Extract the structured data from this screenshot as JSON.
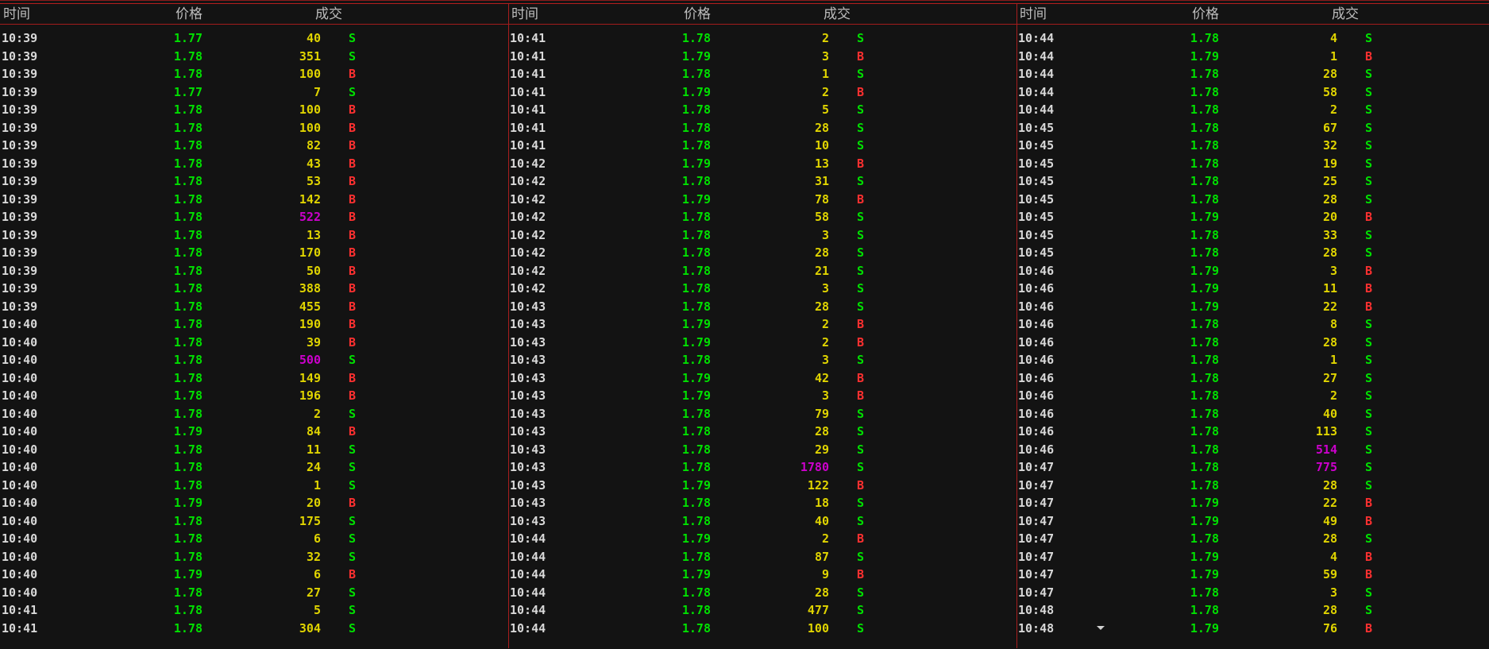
{
  "headers": {
    "time": "时间",
    "price": "价格",
    "volume": "成交"
  },
  "colors": {
    "background": "#131313",
    "price": "#00e000",
    "volume": "#e0d400",
    "volume_large": "#cc00cc",
    "buy": "#ff3030",
    "sell": "#00e000",
    "divider": "#b51f1f"
  },
  "panels": [
    {
      "rows": [
        {
          "time": "10:39",
          "price": "1.77",
          "vol": "40",
          "side": "S"
        },
        {
          "time": "10:39",
          "price": "1.78",
          "vol": "351",
          "side": "S"
        },
        {
          "time": "10:39",
          "price": "1.78",
          "vol": "100",
          "side": "B"
        },
        {
          "time": "10:39",
          "price": "1.77",
          "vol": "7",
          "side": "S"
        },
        {
          "time": "10:39",
          "price": "1.78",
          "vol": "100",
          "side": "B"
        },
        {
          "time": "10:39",
          "price": "1.78",
          "vol": "100",
          "side": "B"
        },
        {
          "time": "10:39",
          "price": "1.78",
          "vol": "82",
          "side": "B"
        },
        {
          "time": "10:39",
          "price": "1.78",
          "vol": "43",
          "side": "B"
        },
        {
          "time": "10:39",
          "price": "1.78",
          "vol": "53",
          "side": "B"
        },
        {
          "time": "10:39",
          "price": "1.78",
          "vol": "142",
          "side": "B"
        },
        {
          "time": "10:39",
          "price": "1.78",
          "vol": "522",
          "side": "B",
          "big": true
        },
        {
          "time": "10:39",
          "price": "1.78",
          "vol": "13",
          "side": "B"
        },
        {
          "time": "10:39",
          "price": "1.78",
          "vol": "170",
          "side": "B"
        },
        {
          "time": "10:39",
          "price": "1.78",
          "vol": "50",
          "side": "B"
        },
        {
          "time": "10:39",
          "price": "1.78",
          "vol": "388",
          "side": "B"
        },
        {
          "time": "10:39",
          "price": "1.78",
          "vol": "455",
          "side": "B"
        },
        {
          "time": "10:40",
          "price": "1.78",
          "vol": "190",
          "side": "B"
        },
        {
          "time": "10:40",
          "price": "1.78",
          "vol": "39",
          "side": "B"
        },
        {
          "time": "10:40",
          "price": "1.78",
          "vol": "500",
          "side": "S",
          "big": true
        },
        {
          "time": "10:40",
          "price": "1.78",
          "vol": "149",
          "side": "B"
        },
        {
          "time": "10:40",
          "price": "1.78",
          "vol": "196",
          "side": "B"
        },
        {
          "time": "10:40",
          "price": "1.78",
          "vol": "2",
          "side": "S"
        },
        {
          "time": "10:40",
          "price": "1.79",
          "vol": "84",
          "side": "B"
        },
        {
          "time": "10:40",
          "price": "1.78",
          "vol": "11",
          "side": "S"
        },
        {
          "time": "10:40",
          "price": "1.78",
          "vol": "24",
          "side": "S"
        },
        {
          "time": "10:40",
          "price": "1.78",
          "vol": "1",
          "side": "S"
        },
        {
          "time": "10:40",
          "price": "1.79",
          "vol": "20",
          "side": "B"
        },
        {
          "time": "10:40",
          "price": "1.78",
          "vol": "175",
          "side": "S"
        },
        {
          "time": "10:40",
          "price": "1.78",
          "vol": "6",
          "side": "S"
        },
        {
          "time": "10:40",
          "price": "1.78",
          "vol": "32",
          "side": "S"
        },
        {
          "time": "10:40",
          "price": "1.79",
          "vol": "6",
          "side": "B"
        },
        {
          "time": "10:40",
          "price": "1.78",
          "vol": "27",
          "side": "S"
        },
        {
          "time": "10:41",
          "price": "1.78",
          "vol": "5",
          "side": "S"
        },
        {
          "time": "10:41",
          "price": "1.78",
          "vol": "304",
          "side": "S"
        }
      ]
    },
    {
      "rows": [
        {
          "time": "10:41",
          "price": "1.78",
          "vol": "2",
          "side": "S"
        },
        {
          "time": "10:41",
          "price": "1.79",
          "vol": "3",
          "side": "B"
        },
        {
          "time": "10:41",
          "price": "1.78",
          "vol": "1",
          "side": "S"
        },
        {
          "time": "10:41",
          "price": "1.79",
          "vol": "2",
          "side": "B"
        },
        {
          "time": "10:41",
          "price": "1.78",
          "vol": "5",
          "side": "S"
        },
        {
          "time": "10:41",
          "price": "1.78",
          "vol": "28",
          "side": "S"
        },
        {
          "time": "10:41",
          "price": "1.78",
          "vol": "10",
          "side": "S"
        },
        {
          "time": "10:42",
          "price": "1.79",
          "vol": "13",
          "side": "B"
        },
        {
          "time": "10:42",
          "price": "1.78",
          "vol": "31",
          "side": "S"
        },
        {
          "time": "10:42",
          "price": "1.79",
          "vol": "78",
          "side": "B"
        },
        {
          "time": "10:42",
          "price": "1.78",
          "vol": "58",
          "side": "S"
        },
        {
          "time": "10:42",
          "price": "1.78",
          "vol": "3",
          "side": "S"
        },
        {
          "time": "10:42",
          "price": "1.78",
          "vol": "28",
          "side": "S"
        },
        {
          "time": "10:42",
          "price": "1.78",
          "vol": "21",
          "side": "S"
        },
        {
          "time": "10:42",
          "price": "1.78",
          "vol": "3",
          "side": "S"
        },
        {
          "time": "10:43",
          "price": "1.78",
          "vol": "28",
          "side": "S"
        },
        {
          "time": "10:43",
          "price": "1.79",
          "vol": "2",
          "side": "B"
        },
        {
          "time": "10:43",
          "price": "1.79",
          "vol": "2",
          "side": "B"
        },
        {
          "time": "10:43",
          "price": "1.78",
          "vol": "3",
          "side": "S"
        },
        {
          "time": "10:43",
          "price": "1.79",
          "vol": "42",
          "side": "B"
        },
        {
          "time": "10:43",
          "price": "1.79",
          "vol": "3",
          "side": "B"
        },
        {
          "time": "10:43",
          "price": "1.78",
          "vol": "79",
          "side": "S"
        },
        {
          "time": "10:43",
          "price": "1.78",
          "vol": "28",
          "side": "S"
        },
        {
          "time": "10:43",
          "price": "1.78",
          "vol": "29",
          "side": "S"
        },
        {
          "time": "10:43",
          "price": "1.78",
          "vol": "1780",
          "side": "S",
          "big": true
        },
        {
          "time": "10:43",
          "price": "1.79",
          "vol": "122",
          "side": "B"
        },
        {
          "time": "10:43",
          "price": "1.78",
          "vol": "18",
          "side": "S"
        },
        {
          "time": "10:43",
          "price": "1.78",
          "vol": "40",
          "side": "S"
        },
        {
          "time": "10:44",
          "price": "1.79",
          "vol": "2",
          "side": "B"
        },
        {
          "time": "10:44",
          "price": "1.78",
          "vol": "87",
          "side": "S"
        },
        {
          "time": "10:44",
          "price": "1.79",
          "vol": "9",
          "side": "B"
        },
        {
          "time": "10:44",
          "price": "1.78",
          "vol": "28",
          "side": "S"
        },
        {
          "time": "10:44",
          "price": "1.78",
          "vol": "477",
          "side": "S"
        },
        {
          "time": "10:44",
          "price": "1.78",
          "vol": "100",
          "side": "S"
        }
      ]
    },
    {
      "rows": [
        {
          "time": "10:44",
          "price": "1.78",
          "vol": "4",
          "side": "S"
        },
        {
          "time": "10:44",
          "price": "1.79",
          "vol": "1",
          "side": "B"
        },
        {
          "time": "10:44",
          "price": "1.78",
          "vol": "28",
          "side": "S"
        },
        {
          "time": "10:44",
          "price": "1.78",
          "vol": "58",
          "side": "S"
        },
        {
          "time": "10:44",
          "price": "1.78",
          "vol": "2",
          "side": "S"
        },
        {
          "time": "10:45",
          "price": "1.78",
          "vol": "67",
          "side": "S"
        },
        {
          "time": "10:45",
          "price": "1.78",
          "vol": "32",
          "side": "S"
        },
        {
          "time": "10:45",
          "price": "1.78",
          "vol": "19",
          "side": "S"
        },
        {
          "time": "10:45",
          "price": "1.78",
          "vol": "25",
          "side": "S"
        },
        {
          "time": "10:45",
          "price": "1.78",
          "vol": "28",
          "side": "S"
        },
        {
          "time": "10:45",
          "price": "1.79",
          "vol": "20",
          "side": "B"
        },
        {
          "time": "10:45",
          "price": "1.78",
          "vol": "33",
          "side": "S"
        },
        {
          "time": "10:45",
          "price": "1.78",
          "vol": "28",
          "side": "S"
        },
        {
          "time": "10:46",
          "price": "1.79",
          "vol": "3",
          "side": "B"
        },
        {
          "time": "10:46",
          "price": "1.79",
          "vol": "11",
          "side": "B"
        },
        {
          "time": "10:46",
          "price": "1.79",
          "vol": "22",
          "side": "B"
        },
        {
          "time": "10:46",
          "price": "1.78",
          "vol": "8",
          "side": "S"
        },
        {
          "time": "10:46",
          "price": "1.78",
          "vol": "28",
          "side": "S"
        },
        {
          "time": "10:46",
          "price": "1.78",
          "vol": "1",
          "side": "S"
        },
        {
          "time": "10:46",
          "price": "1.78",
          "vol": "27",
          "side": "S"
        },
        {
          "time": "10:46",
          "price": "1.78",
          "vol": "2",
          "side": "S"
        },
        {
          "time": "10:46",
          "price": "1.78",
          "vol": "40",
          "side": "S"
        },
        {
          "time": "10:46",
          "price": "1.78",
          "vol": "113",
          "side": "S"
        },
        {
          "time": "10:46",
          "price": "1.78",
          "vol": "514",
          "side": "S",
          "big": true
        },
        {
          "time": "10:47",
          "price": "1.78",
          "vol": "775",
          "side": "S",
          "big": true
        },
        {
          "time": "10:47",
          "price": "1.78",
          "vol": "28",
          "side": "S"
        },
        {
          "time": "10:47",
          "price": "1.79",
          "vol": "22",
          "side": "B"
        },
        {
          "time": "10:47",
          "price": "1.79",
          "vol": "49",
          "side": "B"
        },
        {
          "time": "10:47",
          "price": "1.78",
          "vol": "28",
          "side": "S"
        },
        {
          "time": "10:47",
          "price": "1.79",
          "vol": "4",
          "side": "B"
        },
        {
          "time": "10:47",
          "price": "1.79",
          "vol": "59",
          "side": "B"
        },
        {
          "time": "10:47",
          "price": "1.78",
          "vol": "3",
          "side": "S"
        },
        {
          "time": "10:48",
          "price": "1.78",
          "vol": "28",
          "side": "S"
        },
        {
          "time": "10:48",
          "price": "1.79",
          "vol": "76",
          "side": "B"
        }
      ]
    }
  ]
}
